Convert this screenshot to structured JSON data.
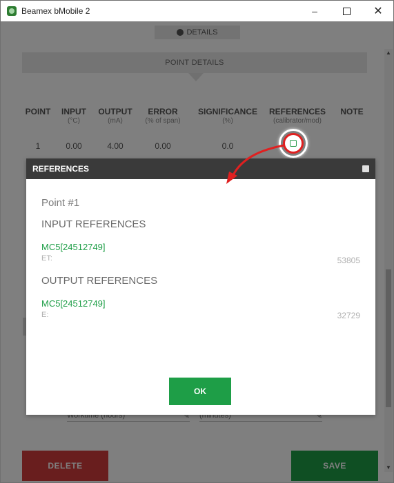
{
  "window": {
    "title": "Beamex bMobile 2",
    "minimize": "–",
    "close": "✕"
  },
  "tabs": {
    "details_label": "DETAILS"
  },
  "point_details": {
    "header": "POINT DETAILS",
    "columns": [
      {
        "label": "POINT",
        "sub": ""
      },
      {
        "label": "INPUT",
        "sub": "(°C)"
      },
      {
        "label": "OUTPUT",
        "sub": "(mA)"
      },
      {
        "label": "ERROR",
        "sub": "(% of span)"
      },
      {
        "label": "SIGNIFICANCE",
        "sub": "(%)"
      },
      {
        "label": "REFERENCES",
        "sub": "(calibrator/mod)"
      },
      {
        "label": "NOTE",
        "sub": ""
      }
    ],
    "row": {
      "point": "1",
      "input": "0.00",
      "output": "4.00",
      "error": "0.00",
      "significance": "0.0"
    }
  },
  "worktime": {
    "hours_placeholder": "Worktime (hours)",
    "minutes_placeholder": "(minutes)"
  },
  "actions": {
    "delete_label": "DELETE",
    "save_label": "SAVE"
  },
  "dialog": {
    "title": "REFERENCES",
    "point_label": "Point #1",
    "input_section": "INPUT REFERENCES",
    "input_ref_name": "MC5[24512749]",
    "input_ref_unit": "ET:",
    "input_ref_value": "53805",
    "output_section": "OUTPUT REFERENCES",
    "output_ref_name": "MC5[24512749]",
    "output_ref_unit": "E:",
    "output_ref_value": "32729",
    "ok_label": "OK"
  },
  "colors": {
    "accent_green": "#1e9e47",
    "delete_red": "#d33c3c",
    "dialog_header": "#3a3a3a",
    "annotation_red": "#e02020"
  },
  "icons": [
    "app-logo-icon",
    "camera-icon",
    "reference-icon",
    "close-icon",
    "pencil-icon",
    "scroll-up-icon",
    "scroll-down-icon",
    "annotation-arrow"
  ]
}
